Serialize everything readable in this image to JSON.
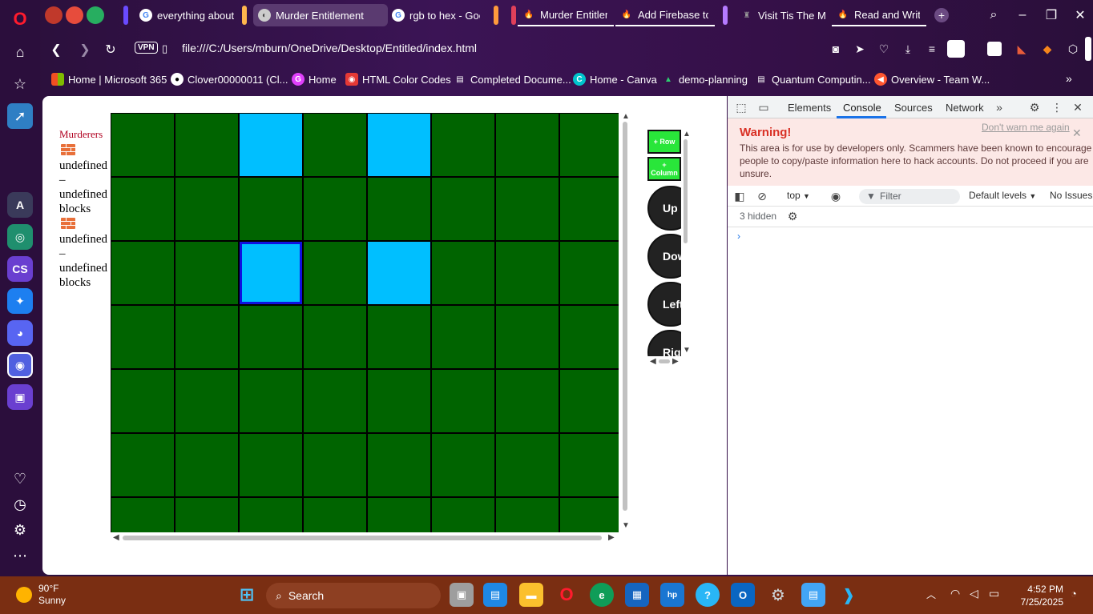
{
  "browser": {
    "tabs": [
      {
        "label": "everything about",
        "fav": "G",
        "fav_color": "#ffffff",
        "active": false
      },
      {
        "label": "Murder Entitlement",
        "fav": "◐",
        "fav_color": "#dddddd",
        "active": true
      },
      {
        "label": "rgb to hex - Goo",
        "fav": "G",
        "fav_color": "#ffffff",
        "active": false
      },
      {
        "label": "Murder Entitleme",
        "fav": "🔥",
        "fav_color": "#ff9800",
        "active": false
      },
      {
        "label": "Add Firebase to y",
        "fav": "🔥",
        "fav_color": "#ff9800",
        "active": false
      },
      {
        "label": "Visit Tis The Morr",
        "fav": "♜",
        "fav_color": "#777777",
        "active": false
      },
      {
        "label": "Read and Write D",
        "fav": "🔥",
        "fav_color": "#ff9800",
        "active": false
      }
    ],
    "new_tab_icon": "plus-icon",
    "vpn_label": "VPN",
    "url": "file:///C:/Users/mburn/OneDrive/Desktop/Entitled/index.html",
    "bookmarks": [
      {
        "label": "Home | Microsoft 365",
        "icon": "microsoft-icon"
      },
      {
        "label": "Clover00000011 (Cl...",
        "icon": "github-icon"
      },
      {
        "label": "Home",
        "icon": "g-icon"
      },
      {
        "label": "HTML Color Codes",
        "icon": "colorcodes-icon"
      },
      {
        "label": "Completed Docume...",
        "icon": "document-icon"
      },
      {
        "label": "Home - Canva",
        "icon": "canva-icon"
      },
      {
        "label": "demo-planning",
        "icon": "jira-icon"
      },
      {
        "label": "Quantum Computin...",
        "icon": "document-icon"
      },
      {
        "label": "Overview - Team W...",
        "icon": "overview-icon"
      }
    ]
  },
  "page": {
    "murderers_title": "Murderers",
    "entries": [
      {
        "line1": "undefined",
        "line2": "–",
        "line3": "undefined",
        "line4": "blocks"
      },
      {
        "line1": "undefined",
        "line2": "–",
        "line3": "undefined",
        "line4": "blocks"
      }
    ],
    "grid": {
      "cols": 8,
      "rows": 7,
      "cell_color": "#006400",
      "highlight_color": "#00bfff",
      "selected_border": "#1010e0",
      "highlighted_cells": [
        [
          0,
          2
        ],
        [
          0,
          4
        ],
        [
          2,
          2
        ],
        [
          2,
          4
        ]
      ],
      "selected_cell": [
        2,
        2
      ]
    },
    "controls": {
      "add_row": "+ Row",
      "add_column": "+ Column",
      "up": "Up",
      "down": "Down",
      "left": "Left",
      "right": "Right"
    }
  },
  "devtools": {
    "tabs": [
      "Elements",
      "Console",
      "Sources",
      "Network"
    ],
    "active_tab": "Console",
    "warning_title": "Warning!",
    "warning_dismiss": "Don't warn me again",
    "warning_body": "This area is for use by developers only. Scammers have been known to encourage people to copy/paste information here to hack accounts. Do not proceed if you are unsure.",
    "context": "top",
    "filter_placeholder": "Filter",
    "levels": "Default levels",
    "issues": "No Issues",
    "hidden_count": "3 hidden",
    "prompt": "›"
  },
  "taskbar": {
    "temperature": "90°F",
    "condition": "Sunny",
    "search_placeholder": "Search",
    "time": "4:52 PM",
    "date": "7/25/2025"
  }
}
